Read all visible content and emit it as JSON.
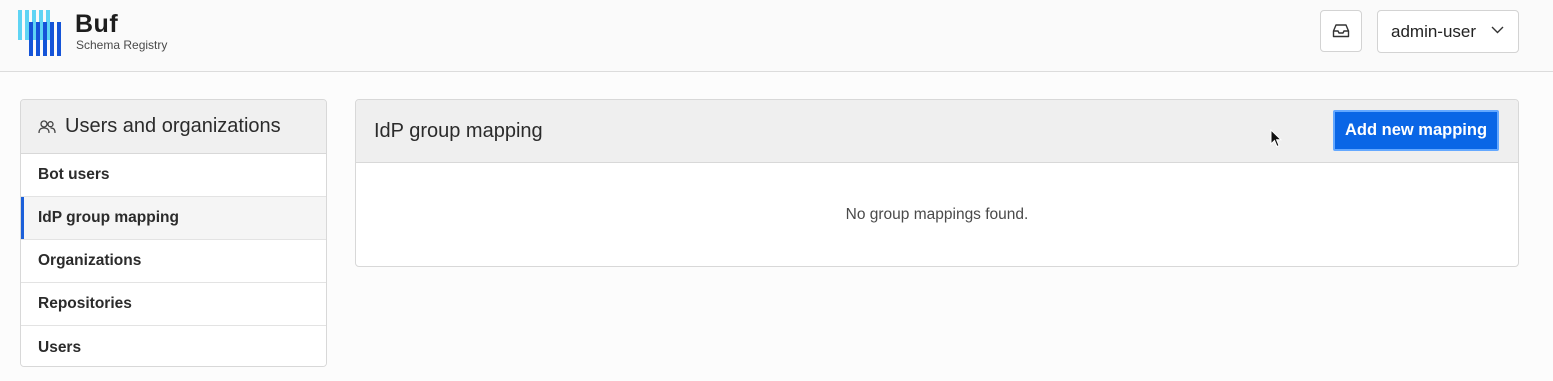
{
  "header": {
    "logo_title": "Buf",
    "logo_subtitle": "Schema Registry",
    "inbox_icon": "inbox-icon",
    "user_menu_label": "admin-user",
    "user_menu_icon": "chevron-down-icon"
  },
  "sidebar": {
    "title": "Users and organizations",
    "title_icon": "users-icon",
    "items": [
      {
        "label": "Bot users",
        "active": false
      },
      {
        "label": "IdP group mapping",
        "active": true
      },
      {
        "label": "Organizations",
        "active": false
      },
      {
        "label": "Repositories",
        "active": false
      },
      {
        "label": "Users",
        "active": false
      }
    ]
  },
  "main": {
    "title": "IdP group mapping",
    "add_button_label": "Add new mapping",
    "empty_message": "No group mappings found."
  },
  "colors": {
    "accent": "#0a66e6",
    "active_indicator": "#1b5fd9",
    "logo_light": "#5fd4f4",
    "logo_dark": "#1554d8"
  }
}
